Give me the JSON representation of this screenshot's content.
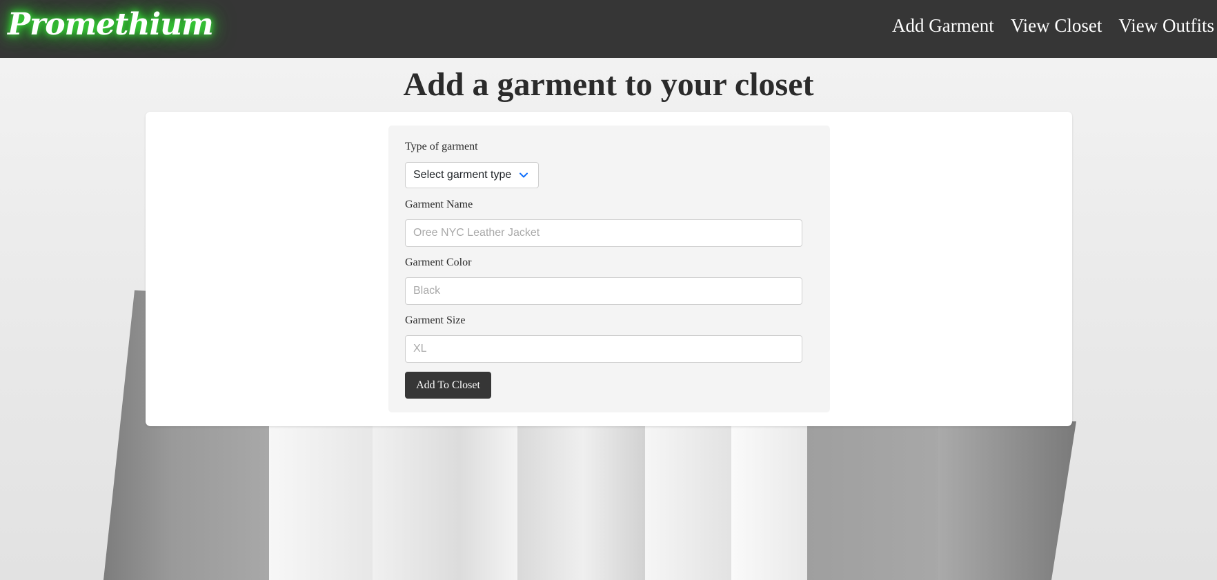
{
  "navbar": {
    "brand": "Promethium",
    "links": [
      {
        "label": "Add Garment"
      },
      {
        "label": "View Closet"
      },
      {
        "label": "View Outfits"
      }
    ]
  },
  "page": {
    "title": "Add a garment to your closet"
  },
  "form": {
    "type_label": "Type of garment",
    "type_select_value": "Select garment type",
    "name_label": "Garment Name",
    "name_placeholder": "Oree NYC Leather Jacket",
    "color_label": "Garment Color",
    "color_placeholder": "Black",
    "size_label": "Garment Size",
    "size_placeholder": "XL",
    "submit_label": "Add To Closet"
  },
  "colors": {
    "navbar_bg": "#363636",
    "brand_glow": "#3cff3c",
    "chevron": "#0d6efd",
    "button_bg": "#363636"
  },
  "icons": {
    "select_chevron": "chevron-down-icon"
  }
}
